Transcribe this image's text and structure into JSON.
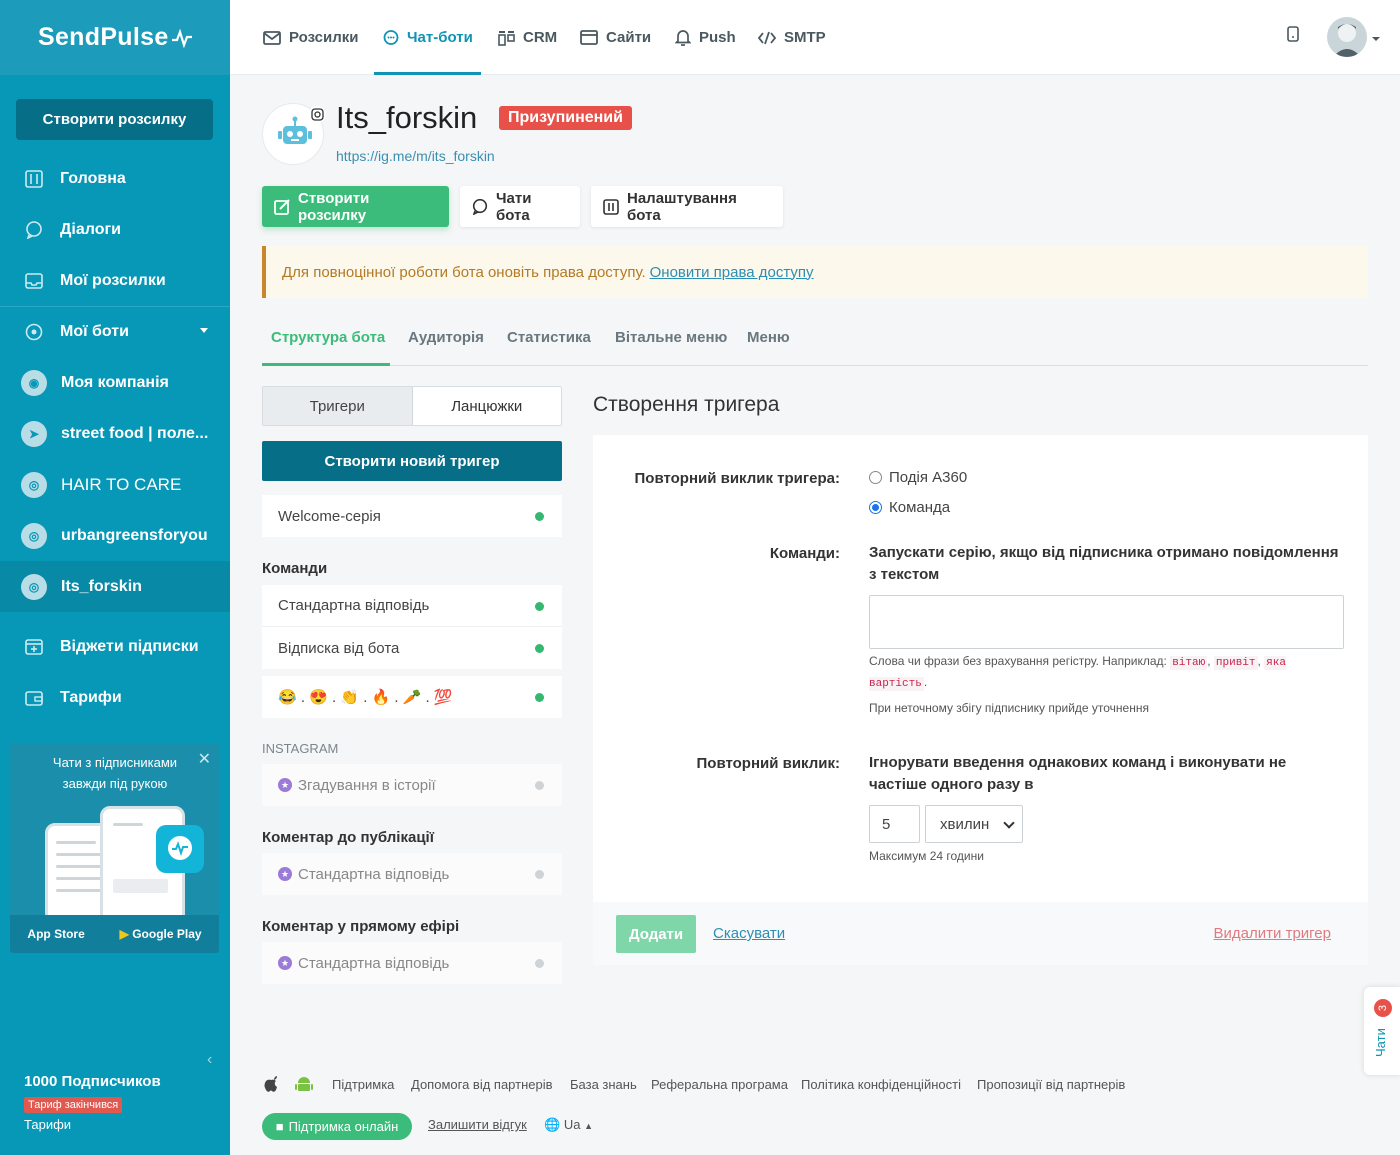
{
  "brand": {
    "logo": "SendPulse"
  },
  "sidebar": {
    "create_button": "Створити розсилку",
    "items": [
      {
        "label": "Головна",
        "icon": "dashboard-icon"
      },
      {
        "label": "Діалоги",
        "icon": "chat-bubble-icon"
      },
      {
        "label": "Мої розсилки",
        "icon": "inbox-icon"
      },
      {
        "label": "Мої боти",
        "icon": "bot-icon"
      },
      {
        "label": "Моя компанія",
        "icon": "messenger-icon"
      },
      {
        "label": "street food | поле...",
        "icon": "telegram-icon"
      },
      {
        "label": "HAIR TO CARE",
        "icon": "instagram-icon"
      },
      {
        "label": "urbangreensforyou",
        "icon": "instagram-icon"
      },
      {
        "label": "Its_forskin",
        "icon": "instagram-icon"
      },
      {
        "label": "Віджети підписки",
        "icon": "widget-icon"
      },
      {
        "label": "Тарифи",
        "icon": "wallet-icon"
      }
    ],
    "promo": {
      "text": "Чати з підписниками завжди під рукою",
      "app_store": "App Store",
      "google_play": "Google Play"
    },
    "subscribers": "1000 Подписчиков",
    "tariff_badge": "Тариф закінчився",
    "tariffs_link": "Тарифи"
  },
  "topnav": {
    "items": [
      {
        "label": "Розсилки",
        "icon": "mail-icon"
      },
      {
        "label": "Чат-боти",
        "icon": "chatbot-icon"
      },
      {
        "label": "CRM",
        "icon": "crm-icon"
      },
      {
        "label": "Сайти",
        "icon": "website-icon"
      },
      {
        "label": "Push",
        "icon": "bell-icon"
      },
      {
        "label": "SMTP",
        "icon": "code-icon"
      }
    ],
    "active": "Чат-боти"
  },
  "bot": {
    "name": "Its_forskin",
    "status": "Призупинений",
    "link": "https://ig.me/m/its_forskin"
  },
  "actions": {
    "create": "Створити розсилку",
    "chats": "Чати бота",
    "settings": "Налаштування бота"
  },
  "alert": {
    "text": "Для повноцінної роботи бота оновіть права доступу.",
    "link": "Оновити права доступу"
  },
  "tabs": [
    "Структура бота",
    "Аудиторія",
    "Статистика",
    "Вітальне меню",
    "Меню"
  ],
  "left": {
    "segment": {
      "triggers": "Тригери",
      "chains": "Ланцюжки"
    },
    "new_trigger": "Створити новий тригер",
    "welcome": "Welcome-серія",
    "commands_title": "Команди",
    "commands": [
      "Стандартна відповідь",
      "Відписка від бота",
      "😂 . 😍 . 👏 . 🔥 . 🥕 . 💯"
    ],
    "instagram_title": "INSTAGRAM",
    "story_mention": "Згадування в історії",
    "post_comment_title": "Коментар до публікації",
    "post_comment": "Стандартна відповідь",
    "live_comment_title": "Коментар у прямому ефірі",
    "live_comment": "Стандартна відповідь"
  },
  "form": {
    "title": "Створення тригера",
    "repeat_label": "Повторний виклик тригера:",
    "option_event": "Подія A360",
    "option_command": "Команда",
    "commands_label": "Команди:",
    "commands_text": "Запускати серію, якщо від підписника отримано повідомлення з текстом",
    "hint_prefix": "Слова чи фрази без врахування регістру. Наприклад:",
    "hint_codes": [
      "вітаю",
      "привіт",
      "яка вартість"
    ],
    "hint2": "При неточному збігу підписнику прийде уточнення",
    "repeat_call_label": "Повторний виклик:",
    "repeat_call_text": "Ігнорувати введення однакових команд і виконувати не частіше одного разу в",
    "interval_value": "5",
    "interval_unit": "хвилин",
    "max_hint": "Максимум 24 години",
    "add": "Додати",
    "cancel": "Скасувати",
    "delete": "Видалити тригер"
  },
  "chats_widget": {
    "label": "Чати",
    "count": "3"
  },
  "footer": {
    "links": [
      "Підтримка",
      "Допомога від партнерів",
      "База знань",
      "Реферальна програма",
      "Політика конфіденційності",
      "Пропозиції від партнерів"
    ],
    "support_online": "Підтримка онлайн",
    "feedback": "Залишити відгук",
    "lang": "Ua"
  },
  "colors": {
    "sidebar": "#0797b7",
    "accent_green": "#3bbc7a",
    "brand_blue": "#0f94b4",
    "paused_red": "#e85149"
  }
}
